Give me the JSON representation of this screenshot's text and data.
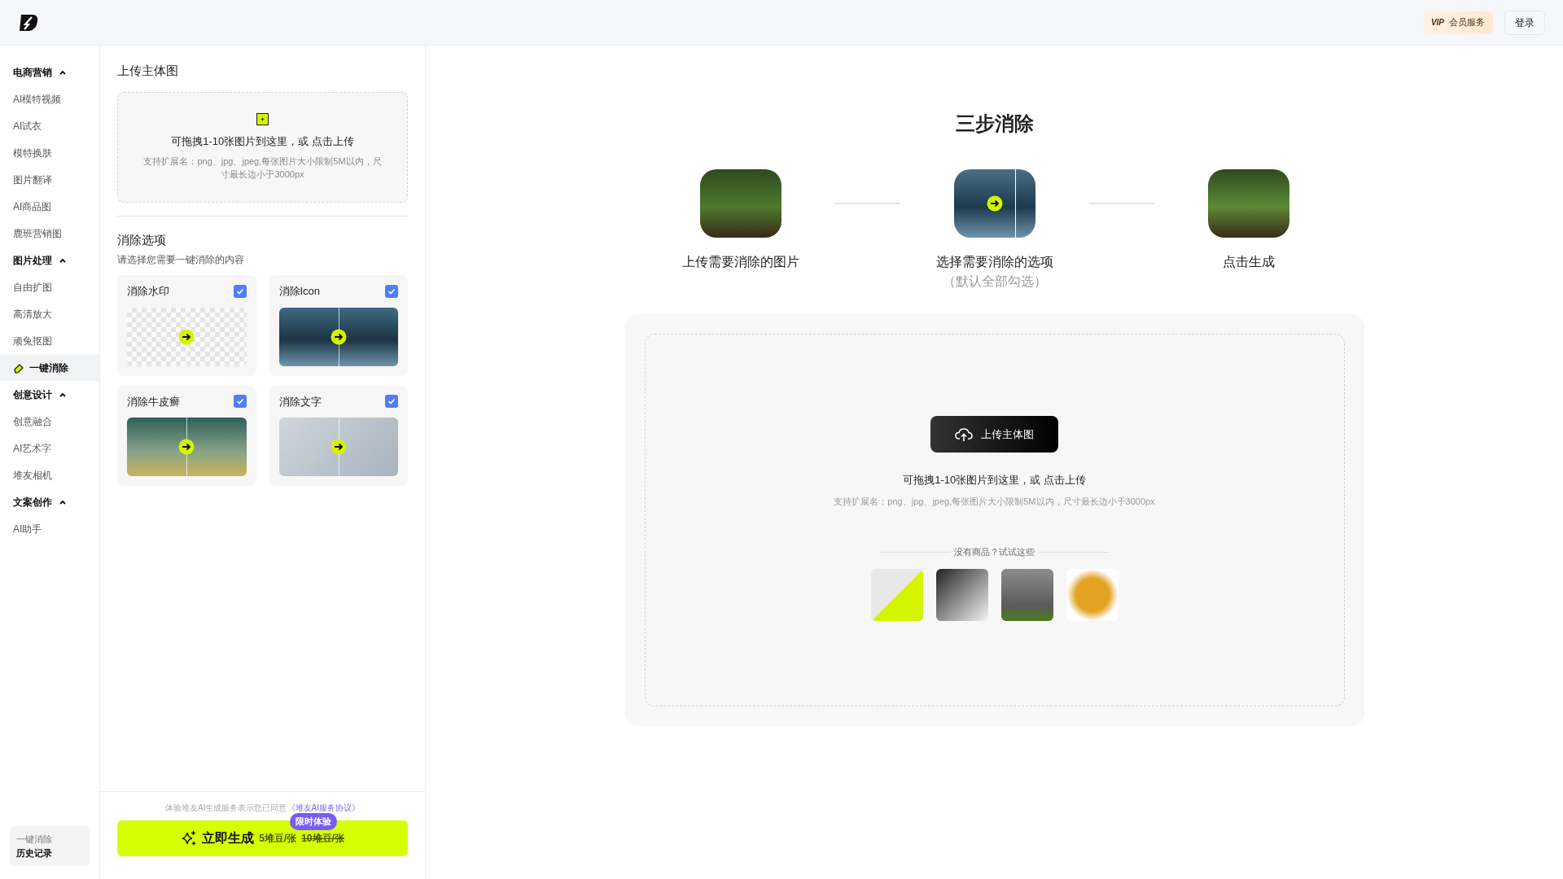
{
  "header": {
    "vip_badge": "VIP",
    "vip_label": "会员服务",
    "login": "登录"
  },
  "sidebar": {
    "sections": [
      {
        "title": "电商营销",
        "expanded": true,
        "items": [
          {
            "label": "AI模特视频",
            "selected": false
          },
          {
            "label": "AI试衣",
            "selected": false
          },
          {
            "label": "模特换肤",
            "selected": false
          },
          {
            "label": "图片翻译",
            "selected": false
          },
          {
            "label": "AI商品图",
            "selected": false
          },
          {
            "label": "鹿班营销图",
            "selected": false
          }
        ]
      },
      {
        "title": "图片处理",
        "expanded": true,
        "items": [
          {
            "label": "自由扩图",
            "selected": false
          },
          {
            "label": "高清放大",
            "selected": false
          },
          {
            "label": "顽兔抠图",
            "selected": false
          },
          {
            "label": "一键消除",
            "selected": true
          }
        ]
      },
      {
        "title": "创意设计",
        "expanded": true,
        "items": [
          {
            "label": "创意融合",
            "selected": false
          },
          {
            "label": "AI艺术字",
            "selected": false
          },
          {
            "label": "堆友相机",
            "selected": false
          }
        ]
      },
      {
        "title": "文案创作",
        "expanded": true,
        "items": [
          {
            "label": "AI助手",
            "selected": false
          }
        ]
      }
    ],
    "history": {
      "line1": "一键消除",
      "line2": "历史记录"
    }
  },
  "panel": {
    "upload_title": "上传主体图",
    "upload_hint": "可拖拽1-10张图片到这里，或 点击上传",
    "upload_formats": "支持扩展名：png、jpg、jpeg,每张图片大小限制5M以内，尺寸最长边小于3000px",
    "options_title": "消除选项",
    "options_subtitle": "请选择您需要一键消除的内容",
    "options": [
      {
        "label": "消除水印",
        "checked": true
      },
      {
        "label": "消除Icon",
        "checked": true
      },
      {
        "label": "消除牛皮癣",
        "checked": true
      },
      {
        "label": "消除文字",
        "checked": true
      }
    ],
    "agreement": "体验堆友AI生成服务表示您已同意",
    "agreement_link": "《堆友AI服务协议》",
    "generate": {
      "label": "立即生成",
      "price": "5堆豆/张",
      "old_price": "10堆豆/张",
      "badge": "限时体验"
    }
  },
  "main": {
    "title": "三步消除",
    "steps": [
      {
        "label": "上传需要消除的图片"
      },
      {
        "label": "选择需要消除的选项",
        "note": "（默认全部勾选）"
      },
      {
        "label": "点击生成"
      }
    ],
    "upload_button": "上传主体图",
    "upload_hint": "可拖拽1-10张图片到这里，或 点击上传",
    "upload_formats": "支持扩展名：png、jpg、jpeg,每张图片大小限制5M以内，尺寸最长边小于3000px",
    "samples_title": "没有商品？试试这些"
  }
}
